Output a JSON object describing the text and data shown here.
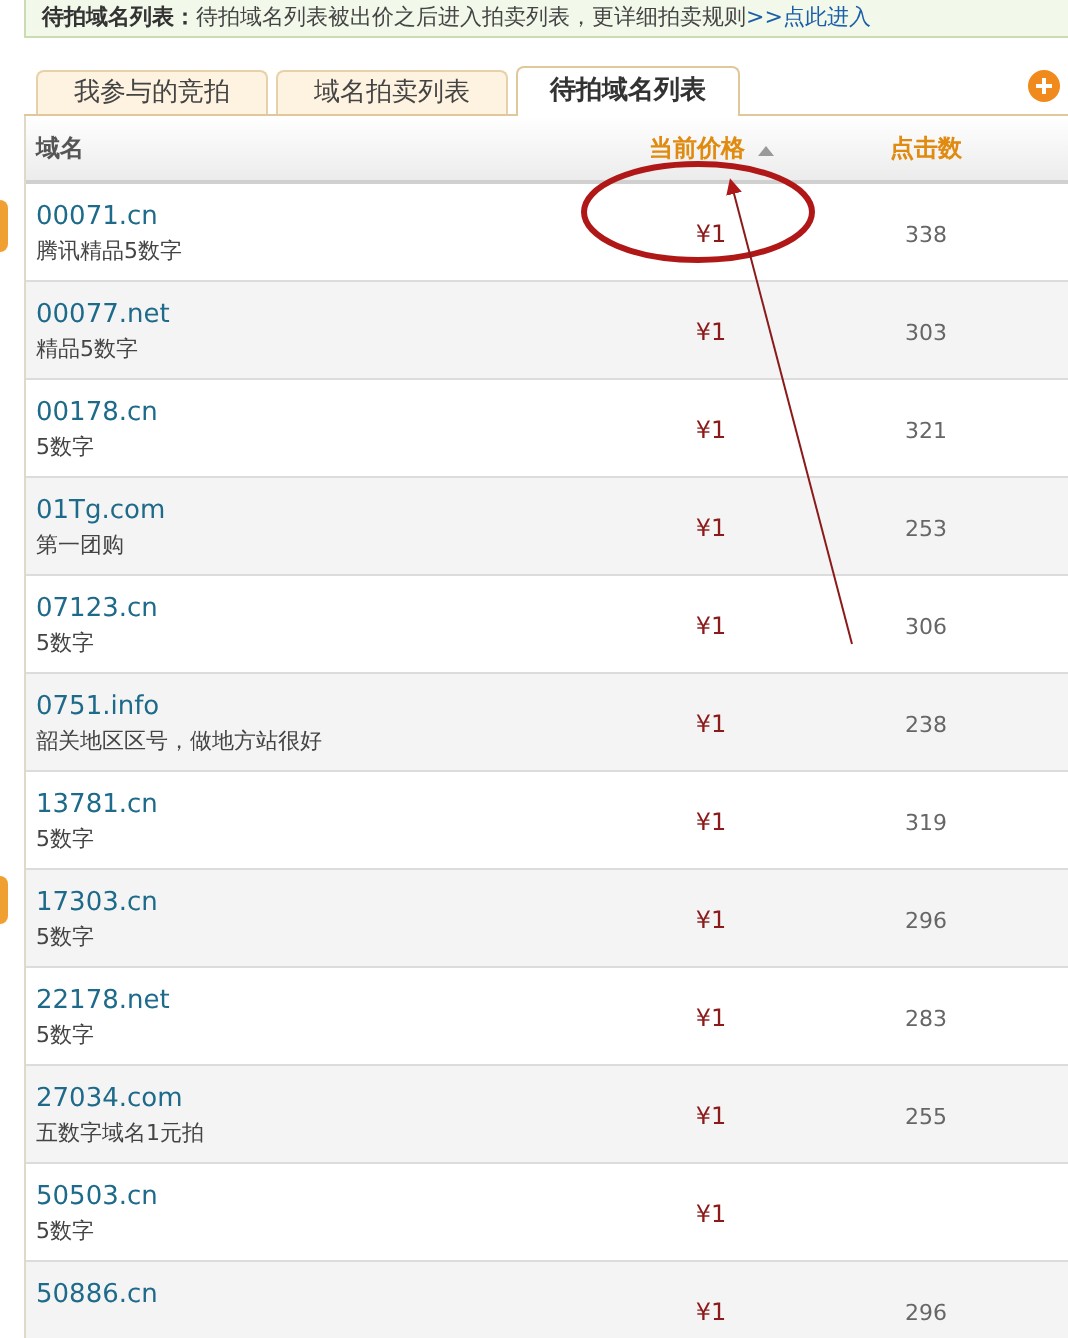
{
  "notice": {
    "label": "待拍域名列表：",
    "text": "待拍域名列表被出价之后进入拍卖列表，更详细拍卖规则",
    "link": ">>点此进入"
  },
  "tabs": [
    {
      "label": "我参与的竞拍",
      "selected": false
    },
    {
      "label": "域名拍卖列表",
      "selected": false
    },
    {
      "label": "待拍域名列表",
      "selected": true
    }
  ],
  "table": {
    "columns": [
      {
        "label": "域名",
        "sorted_ascending": false
      },
      {
        "label": "当前价格",
        "sorted_ascending": true
      },
      {
        "label": "点击数",
        "sorted_ascending": false
      }
    ],
    "rows": [
      {
        "domain": "00071.cn",
        "description": "腾讯精品5数字",
        "price": "¥1",
        "clicks": "338"
      },
      {
        "domain": "00077.net",
        "description": "精品5数字",
        "price": "¥1",
        "clicks": "303"
      },
      {
        "domain": "00178.cn",
        "description": "5数字",
        "price": "¥1",
        "clicks": "321"
      },
      {
        "domain": "01Tg.com",
        "description": "第一团购",
        "price": "¥1",
        "clicks": "253"
      },
      {
        "domain": "07123.cn",
        "description": "5数字",
        "price": "¥1",
        "clicks": "306"
      },
      {
        "domain": "0751.info",
        "description": "韶关地区区号，做地方站很好",
        "price": "¥1",
        "clicks": "238"
      },
      {
        "domain": "13781.cn",
        "description": "5数字",
        "price": "¥1",
        "clicks": "319"
      },
      {
        "domain": "17303.cn",
        "description": "5数字",
        "price": "¥1",
        "clicks": "296"
      },
      {
        "domain": "22178.net",
        "description": "5数字",
        "price": "¥1",
        "clicks": "283"
      },
      {
        "domain": "27034.com",
        "description": "五数字域名1元拍",
        "price": "¥1",
        "clicks": "255"
      },
      {
        "domain": "50503.cn",
        "description": "5数字",
        "price": "¥1"
      },
      {
        "domain": "50886.cn",
        "price": "¥1",
        "clicks": "296"
      }
    ]
  }
}
